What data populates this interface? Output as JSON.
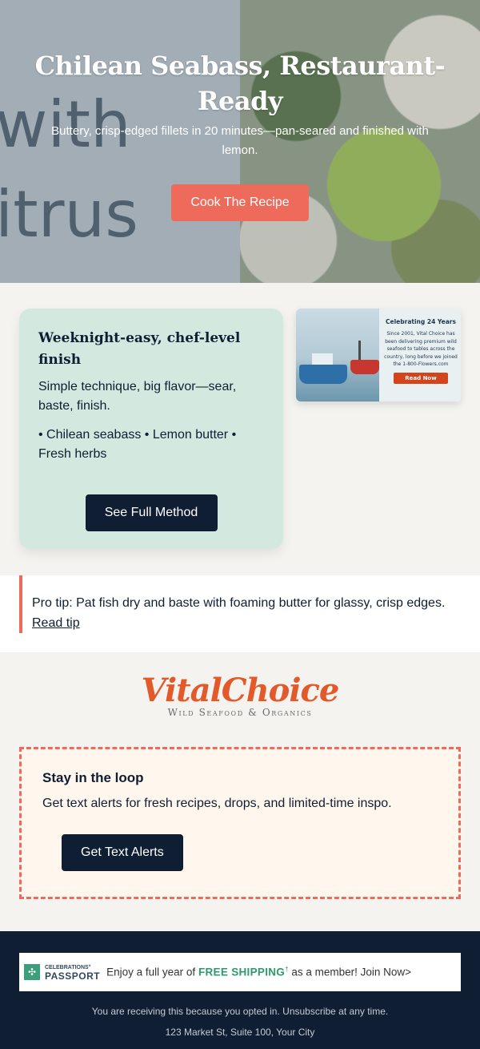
{
  "hero": {
    "background_text": [
      "with",
      "itrus"
    ],
    "title": "Chilean Seabass, Restaurant-Ready",
    "subtitle": "Buttery, crisp-edged fillets in 20 minutes—pan-seared and finished with lemon.",
    "cta_label": "Cook The Recipe"
  },
  "feature_card": {
    "title": "Weeknight-easy, chef-level finish",
    "text": "Simple technique, big flavor—sear, baste, finish.",
    "ingredients": "• Chilean seabass • Lemon butter • Fresh herbs",
    "cta_label": "See Full Method"
  },
  "ad_banner": {
    "title": "Celebrating 24 Years",
    "body": "Since 2001, Vital Choice has been delivering premium wild seafood to tables across the country, long before we joined the 1-800-Flowers.com",
    "cta_label": "Read Now"
  },
  "pro_tip": {
    "text": "Pro tip: Pat fish dry and baste with foaming butter for glassy, crisp edges.",
    "link_label": "Read tip"
  },
  "logo": {
    "name": "VitalChoice",
    "tagline": "Wild Seafood & Organics"
  },
  "sms_signup": {
    "title": "Stay in the loop",
    "text": "Get text alerts for fresh recipes, drops, and limited-time inspo.",
    "cta_label": "Get Text Alerts"
  },
  "footer": {
    "passport": {
      "brand_top": "CELEBRATIONS°",
      "brand_bottom": "PASSPORT",
      "text_before": "Enjoy a full year of ",
      "free_shipping": "FREE SHIPPING",
      "dagger": "†",
      "text_after": " as a member! Join Now>"
    },
    "opt_in_note": "You are receiving this because you opted in. Unsubscribe at any time.",
    "address": "123 Market St, Suite 100, Your City"
  },
  "colors": {
    "primary_navy": "#0f1e33",
    "accent_coral": "#ee6b5c",
    "card_mint": "#d3e9e0",
    "sms_cream": "#fff7ed",
    "logo_orange": "#e35a2a"
  }
}
